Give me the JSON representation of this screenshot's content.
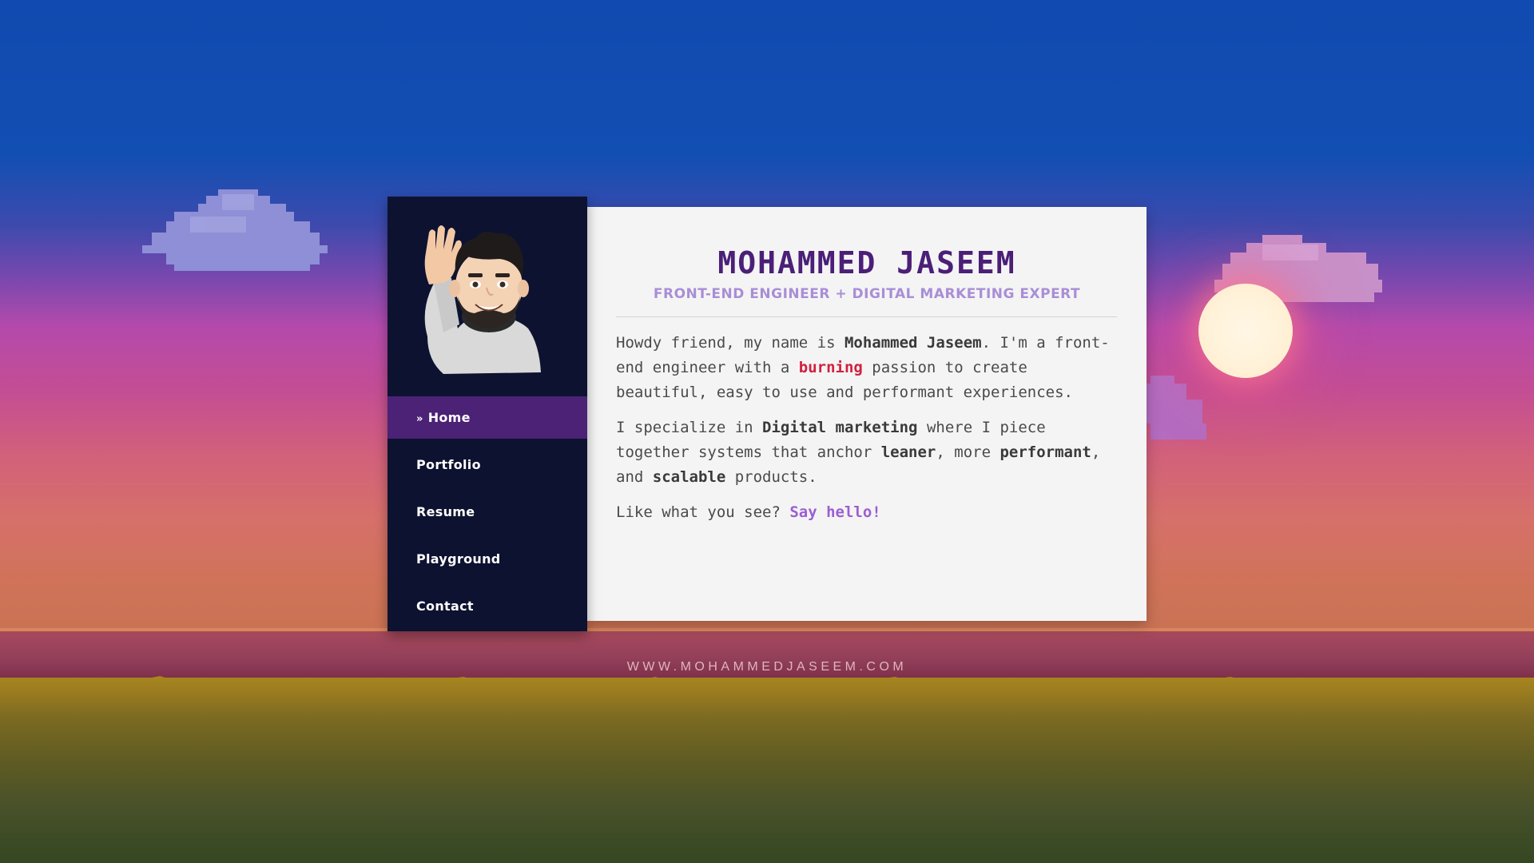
{
  "profile": {
    "name": "MOHAMMED JASEEM",
    "subtitle": "FRONT-END ENGINEER + DIGITAL MARKETING EXPERT"
  },
  "nav": {
    "items": [
      {
        "label": "Home",
        "active": true,
        "prefix": "»"
      },
      {
        "label": "Portfolio",
        "active": false
      },
      {
        "label": "Resume",
        "active": false
      },
      {
        "label": "Playground",
        "active": false
      },
      {
        "label": "Contact",
        "active": false
      }
    ]
  },
  "bio": {
    "p1": {
      "t1": "Howdy friend, my name is ",
      "name": "Mohammed Jaseem",
      "t2": ". I'm a front-end engineer with a ",
      "accent": "burning",
      "t3": " passion to create beautiful, easy to use and performant experiences."
    },
    "p2": {
      "t1": "I specialize in ",
      "b1": "Digital marketing",
      "t2": " where I piece together systems that anchor ",
      "b2": "leaner",
      "t3": ", more ",
      "b3": "performant",
      "t4": ", and ",
      "b4": "scalable",
      "t5": " products."
    },
    "p3": {
      "t1": "Like what you see? ",
      "link": "Say hello!"
    }
  },
  "footer": {
    "url": "WWW.MOHAMMEDJASEEM.COM"
  },
  "colors": {
    "sidebar_bg": "#0d1230",
    "nav_active": "#4b2275",
    "name_color": "#4b1f78",
    "subtitle_color": "#a98ed6",
    "accent_red": "#d0213d",
    "link_purple": "#9b5fd1"
  },
  "icons": {
    "avatar": "waving-memoji-avatar",
    "nav_prefix": "double-chevron-right-icon"
  }
}
